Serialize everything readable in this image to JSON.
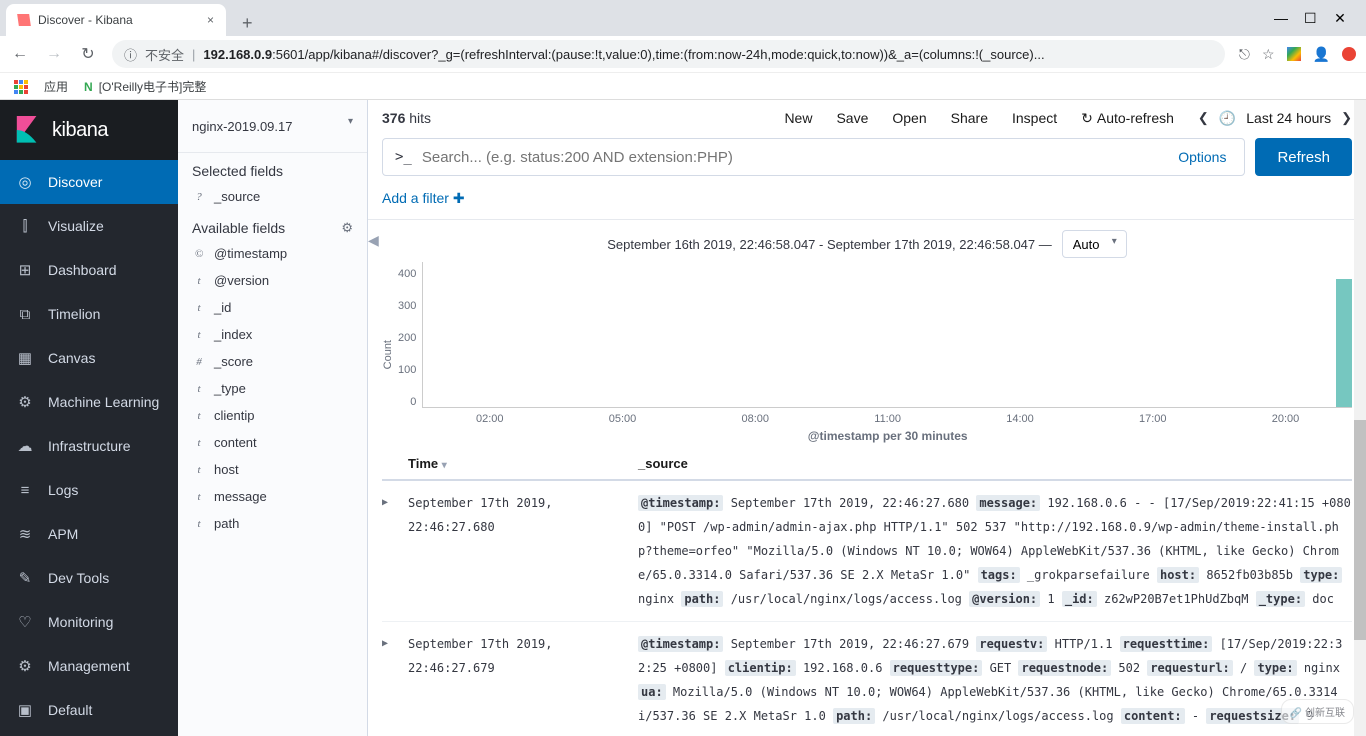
{
  "browser": {
    "tab_title": "Discover - Kibana",
    "security_label": "不安全",
    "url_host": "192.168.0.9",
    "url_rest": ":5601/app/kibana#/discover?_g=(refreshInterval:(pause:!t,value:0),time:(from:now-24h,mode:quick,to:now))&_a=(columns:!(_source)...",
    "apps_label": "应用",
    "bookmark1": "[O'Reilly电子书]完整"
  },
  "sidenav": {
    "logo_text": "kibana",
    "items": [
      {
        "label": "Discover",
        "icon": "◎"
      },
      {
        "label": "Visualize",
        "icon": "⫿"
      },
      {
        "label": "Dashboard",
        "icon": "⊞"
      },
      {
        "label": "Timelion",
        "icon": "⧉"
      },
      {
        "label": "Canvas",
        "icon": "▦"
      },
      {
        "label": "Machine Learning",
        "icon": "⚙"
      },
      {
        "label": "Infrastructure",
        "icon": "☁"
      },
      {
        "label": "Logs",
        "icon": "≡"
      },
      {
        "label": "APM",
        "icon": "≋"
      },
      {
        "label": "Dev Tools",
        "icon": "✎"
      },
      {
        "label": "Monitoring",
        "icon": "♡"
      },
      {
        "label": "Management",
        "icon": "⚙"
      },
      {
        "label": "Default",
        "icon": "▣"
      }
    ]
  },
  "fields_panel": {
    "index_pattern": "nginx-2019.09.17",
    "selected_header": "Selected fields",
    "selected": [
      {
        "type": "?",
        "name": "_source"
      }
    ],
    "available_header": "Available fields",
    "available": [
      {
        "type": "©",
        "name": "@timestamp"
      },
      {
        "type": "t",
        "name": "@version"
      },
      {
        "type": "t",
        "name": "_id"
      },
      {
        "type": "t",
        "name": "_index"
      },
      {
        "type": "#",
        "name": "_score"
      },
      {
        "type": "t",
        "name": "_type"
      },
      {
        "type": "t",
        "name": "clientip"
      },
      {
        "type": "t",
        "name": "content"
      },
      {
        "type": "t",
        "name": "host"
      },
      {
        "type": "t",
        "name": "message"
      },
      {
        "type": "t",
        "name": "path"
      }
    ]
  },
  "topbar": {
    "hits_count": "376",
    "hits_label": "hits",
    "new": "New",
    "save": "Save",
    "open": "Open",
    "share": "Share",
    "inspect": "Inspect",
    "auto_refresh": "Auto-refresh",
    "time_label": "Last 24 hours"
  },
  "search": {
    "placeholder": "Search... (e.g. status:200 AND extension:PHP)",
    "options": "Options",
    "refresh": "Refresh"
  },
  "filter": {
    "add": "Add a filter"
  },
  "chart_header": {
    "range": "September 16th 2019, 22:46:58.047 - September 17th 2019, 22:46:58.047 —",
    "interval": "Auto"
  },
  "chart_data": {
    "type": "bar",
    "ylabel": "Count",
    "ylim": [
      0,
      400
    ],
    "y_ticks": [
      "400",
      "300",
      "200",
      "100",
      "0"
    ],
    "x_ticks": [
      "02:00",
      "05:00",
      "08:00",
      "11:00",
      "14:00",
      "17:00",
      "20:00"
    ],
    "x_label": "@timestamp per 30 minutes",
    "series": [
      {
        "name": "Count",
        "bucket": "22:30",
        "value": 376
      }
    ]
  },
  "table": {
    "col_time": "Time",
    "col_source": "_source",
    "rows": [
      {
        "time": "September 17th 2019, 22:46:27.680",
        "src": [
          {
            "k": "@timestamp:",
            "v": " September 17th 2019, 22:46:27.680 "
          },
          {
            "k": "message:",
            "v": " 192.168.0.6 - - [17/Sep/2019:22:41:15 +0800] \"POST /wp-admin/admin-ajax.php HTTP/1.1\" 502 537 \"http://192.168.0.9/wp-admin/theme-install.php?theme=orfeo\" \"Mozilla/5.0 (Windows NT 10.0; WOW64) AppleWebKit/537.36 (KHTML, like Gecko) Chrome/65.0.3314.0 Safari/537.36 SE 2.X MetaSr 1.0\" "
          },
          {
            "k": "tags:",
            "v": " _grokparsefailure "
          },
          {
            "k": "host:",
            "v": " 8652fb03b85b "
          },
          {
            "k": "type:",
            "v": " nginx "
          },
          {
            "k": "path:",
            "v": " /usr/local/nginx/logs/access.log "
          },
          {
            "k": "@version:",
            "v": " 1 "
          },
          {
            "k": "_id:",
            "v": " z62wP20B7et1PhUdZbqM "
          },
          {
            "k": "_type:",
            "v": " doc"
          }
        ]
      },
      {
        "time": "September 17th 2019, 22:46:27.679",
        "src": [
          {
            "k": "@timestamp:",
            "v": " September 17th 2019, 22:46:27.679 "
          },
          {
            "k": "requestv:",
            "v": " HTTP/1.1 "
          },
          {
            "k": "requesttime:",
            "v": " [17/Sep/2019:22:32:25 +0800] "
          },
          {
            "k": "clientip:",
            "v": " 192.168.0.6 "
          },
          {
            "k": "requesttype:",
            "v": " GET "
          },
          {
            "k": "requestnode:",
            "v": " 502 "
          },
          {
            "k": "requesturl:",
            "v": " / "
          },
          {
            "k": "type:",
            "v": " nginx "
          },
          {
            "k": "ua:",
            "v": " Mozilla/5.0 (Windows NT 10.0; WOW64) AppleWebKit/537.36 (KHTML, like Gecko) Chrome/65.0.3314 i/537.36 SE 2.X MetaSr 1.0 "
          },
          {
            "k": "path:",
            "v": " /usr/local/nginx/logs/access.log "
          },
          {
            "k": "content:",
            "v": " - "
          },
          {
            "k": "requestsize:",
            "v": " 9"
          }
        ]
      }
    ]
  },
  "watermark": "创新互联"
}
